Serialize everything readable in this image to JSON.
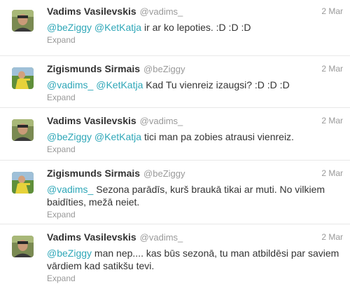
{
  "tweets": [
    {
      "fullname": "Vadims Vasilevskis",
      "username": "@vadims_",
      "time": "2 Mar",
      "mentions": [
        "@beZiggy",
        "@KetKatja"
      ],
      "text": "ir ar ko lepoties. :D :D :D",
      "expand": "Expand",
      "avatar": "avatar-vadims"
    },
    {
      "fullname": "Zigismunds Sirmais",
      "username": "@beZiggy",
      "time": "2 Mar",
      "mentions": [
        "@vadims_",
        "@KetKatja"
      ],
      "text": "Kad Tu vienreiz izaugsi? :D :D :D",
      "expand": "Expand",
      "avatar": "avatar-ziggy"
    },
    {
      "fullname": "Vadims Vasilevskis",
      "username": "@vadims_",
      "time": "2 Mar",
      "mentions": [
        "@beZiggy",
        "@KetKatja"
      ],
      "text": "tici man pa zobies atrausi vienreiz.",
      "expand": "Expand",
      "avatar": "avatar-vadims"
    },
    {
      "fullname": "Zigismunds Sirmais",
      "username": "@beZiggy",
      "time": "2 Mar",
      "mentions": [
        "@vadims_"
      ],
      "text": " Sezona parādīs, kurš braukā tikai ar muti. No vilkiem baidīties, mežā neiet.",
      "expand": "Expand",
      "avatar": "avatar-ziggy"
    },
    {
      "fullname": "Vadims Vasilevskis",
      "username": "@vadims_",
      "time": "2 Mar",
      "mentions": [
        "@beZiggy"
      ],
      "text": "man nep.... kas būs sezonā, tu man atbildēsi par saviem vārdiem kad satikšu tevi.",
      "expand": "Expand",
      "avatar": "avatar-vadims"
    }
  ],
  "colors": {
    "mention": "#2fa7b8",
    "name": "#333333",
    "meta": "#999999",
    "divider": "#e8e8e8"
  }
}
